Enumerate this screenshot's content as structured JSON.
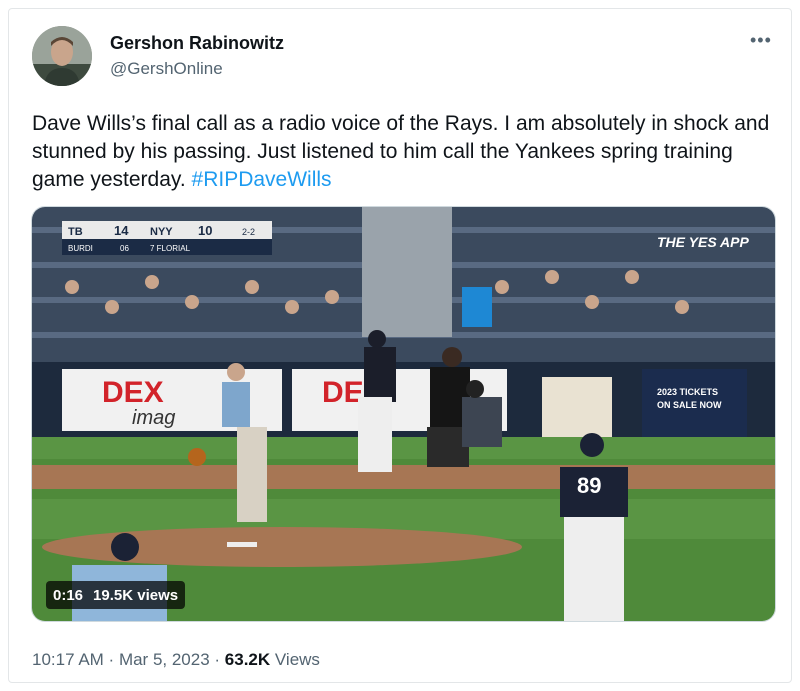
{
  "author": {
    "name": "Gershon Rabinowitz",
    "handle": "@GershOnline"
  },
  "more_label": "•••",
  "tweet": {
    "text": "Dave Wills’s final call as a radio voice of the Rays. I am absolutely in shock and stunned by his passing. Just listened to him call the Yankees spring training game yesterday. ",
    "hashtag": "#RIPDaveWills"
  },
  "video": {
    "duration": "0:16",
    "views": "19.5K views",
    "scorebug": {
      "away_team": "TB",
      "away_score": "14",
      "home_team": "NYY",
      "home_score": "10",
      "count": "2-2",
      "away_sub": "BURDI",
      "away_sub_num": "06",
      "home_sub": "7 FLORIAL"
    },
    "broadcaster": "THE YES APP",
    "board_left": "DEX imaging",
    "board_right": "2023 TICKETS ON SALE NOW",
    "player_number": "89"
  },
  "footer": {
    "time": "10:17 AM",
    "date": "Mar 5, 2023",
    "views_count": "63.2K",
    "views_label": "Views"
  }
}
